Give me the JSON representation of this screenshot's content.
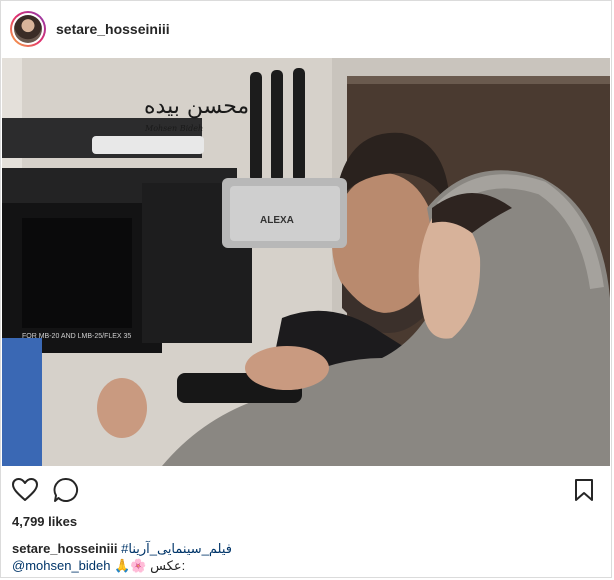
{
  "post": {
    "username": "setare_hosseiniii",
    "likes": "4,799 likes",
    "caption": {
      "username": "setare_hosseiniii",
      "hashtag": "#فیلم_سینمایی_آرینا",
      "credit_mention": "@mohsen_bideh",
      "credit_emoji": "🙏🌸",
      "credit_label": "عکس:"
    }
  },
  "photo": {
    "signature_script": "محسن بیده",
    "signature_latin": "Mohsen Bideh",
    "camera_brand": "ALEXA",
    "lens_label": "FOR MB-20 AND LMB-25/FLEX 35"
  },
  "icons": {
    "like": "heart-icon",
    "comment": "comment-icon",
    "save": "bookmark-icon"
  }
}
